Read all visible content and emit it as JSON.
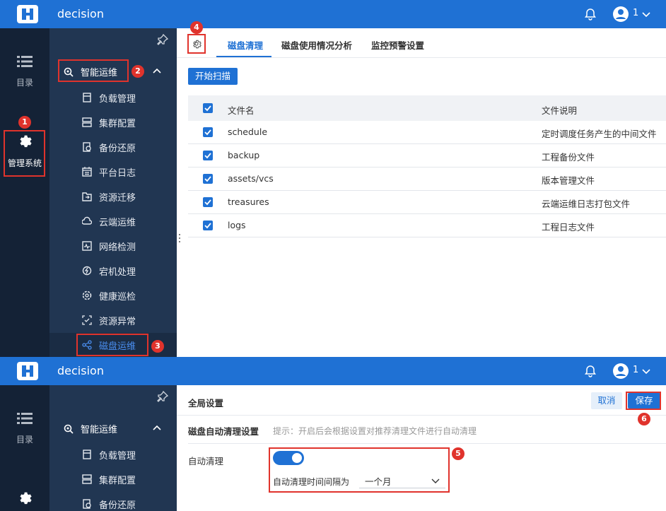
{
  "app": {
    "title": "decision",
    "user": "1"
  },
  "left_nav": {
    "catalog": "目录",
    "admin": "管理系统"
  },
  "sidebar": {
    "group": "智能运维",
    "items": [
      "负载管理",
      "集群配置",
      "备份还原",
      "平台日志",
      "资源迁移",
      "云端运维",
      "网络检测",
      "宕机处理",
      "健康巡检",
      "资源异常",
      "磁盘运维"
    ]
  },
  "tabs": [
    "磁盘清理",
    "磁盘使用情况分析",
    "监控预警设置"
  ],
  "scan_button": "开始扫描",
  "table": {
    "col_name": "文件名",
    "col_desc": "文件说明",
    "rows": [
      {
        "name": "schedule",
        "desc": "定时调度任务产生的中间文件"
      },
      {
        "name": "backup",
        "desc": "工程备份文件"
      },
      {
        "name": "assets/vcs",
        "desc": "版本管理文件"
      },
      {
        "name": "treasures",
        "desc": "云端运维日志打包文件"
      },
      {
        "name": "logs",
        "desc": "工程日志文件"
      }
    ]
  },
  "settings": {
    "title": "全局设置",
    "cancel": "取消",
    "save": "保存",
    "section": "磁盘自动清理设置",
    "hint": "提示：开启后会根据设置对推荐清理文件进行自动清理",
    "auto_label": "自动清理",
    "interval_label": "自动清理时间间隔为",
    "interval_value": "一个月"
  },
  "badges": [
    "1",
    "2",
    "3",
    "4",
    "5",
    "6"
  ],
  "colors": {
    "topbar": "#1f71d4",
    "nav": "#142236",
    "sidebar": "#213652",
    "accent": "#1f71d4",
    "annotation": "#e0332c"
  }
}
